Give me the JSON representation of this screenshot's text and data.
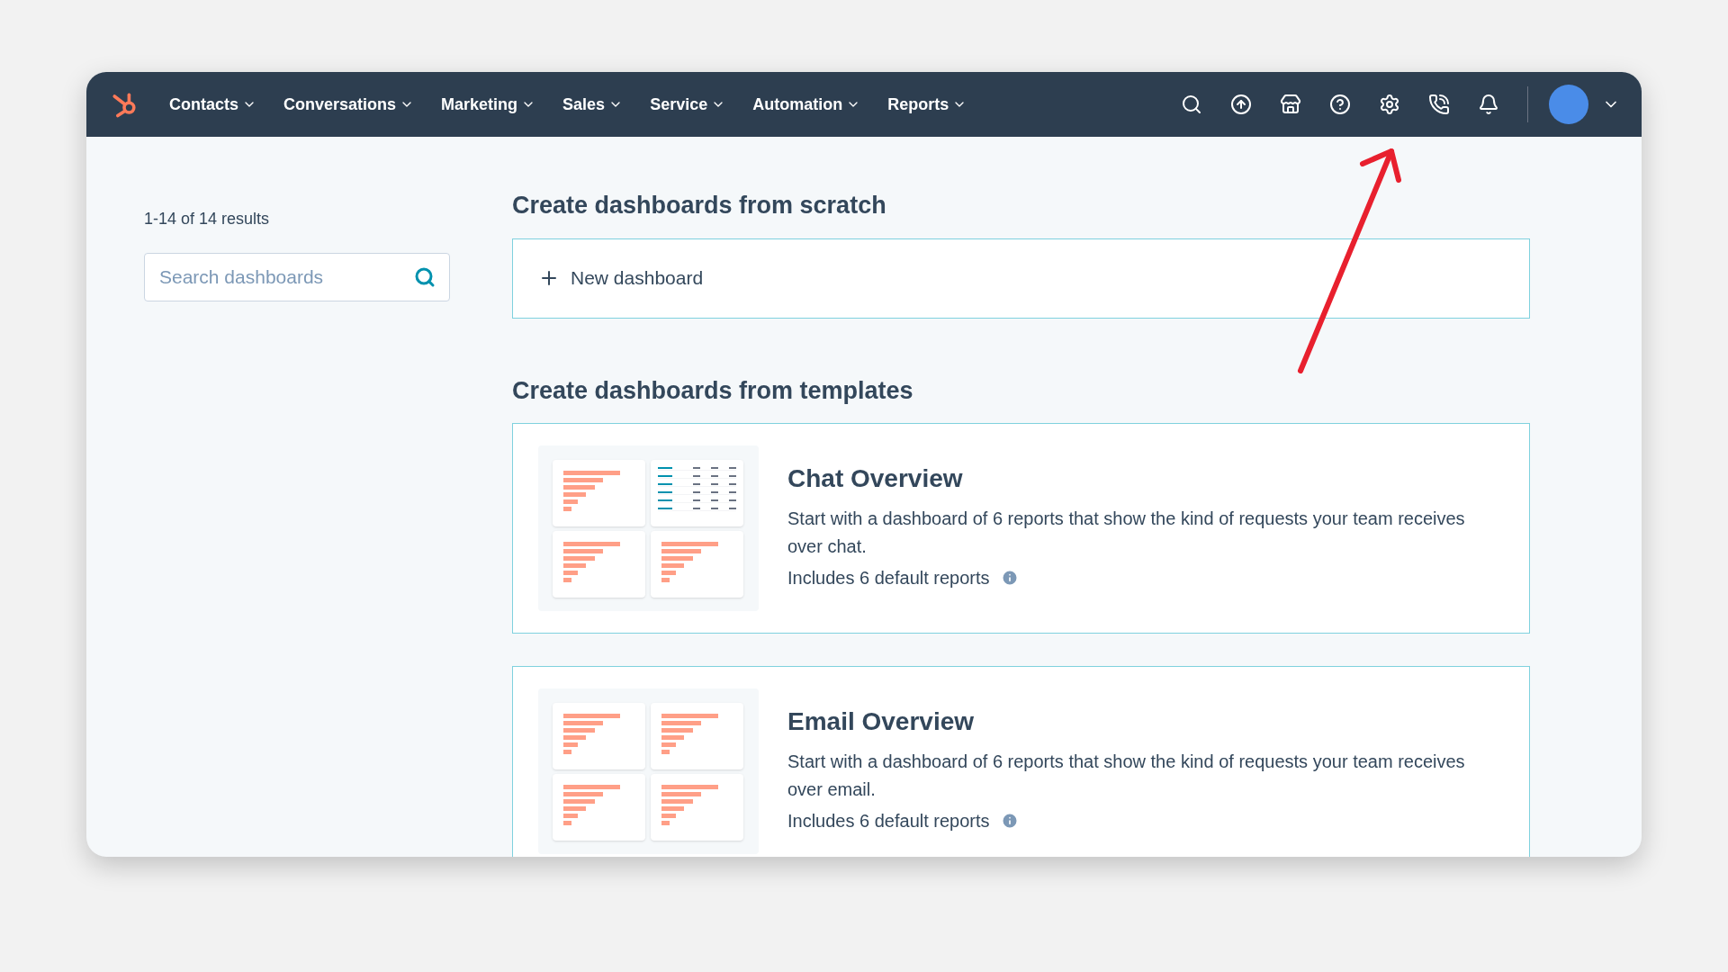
{
  "nav": {
    "items": [
      {
        "label": "Contacts"
      },
      {
        "label": "Conversations"
      },
      {
        "label": "Marketing"
      },
      {
        "label": "Sales"
      },
      {
        "label": "Service"
      },
      {
        "label": "Automation"
      },
      {
        "label": "Reports"
      }
    ]
  },
  "sidebar": {
    "results": "1-14 of 14 results",
    "search": {
      "placeholder": "Search dashboards"
    }
  },
  "scratch": {
    "heading": "Create dashboards from scratch",
    "button": "New dashboard"
  },
  "templates": {
    "heading": "Create dashboards from templates",
    "cards": [
      {
        "title": "Chat Overview",
        "description": "Start with a dashboard of 6 reports that show the kind of requests your team receives over chat.",
        "includes": "Includes 6 default reports",
        "kind": "chat"
      },
      {
        "title": "Email Overview",
        "description": "Start with a dashboard of 6 reports that show the kind of requests your team receives over email.",
        "includes": "Includes 6 default reports",
        "kind": "email"
      }
    ]
  }
}
